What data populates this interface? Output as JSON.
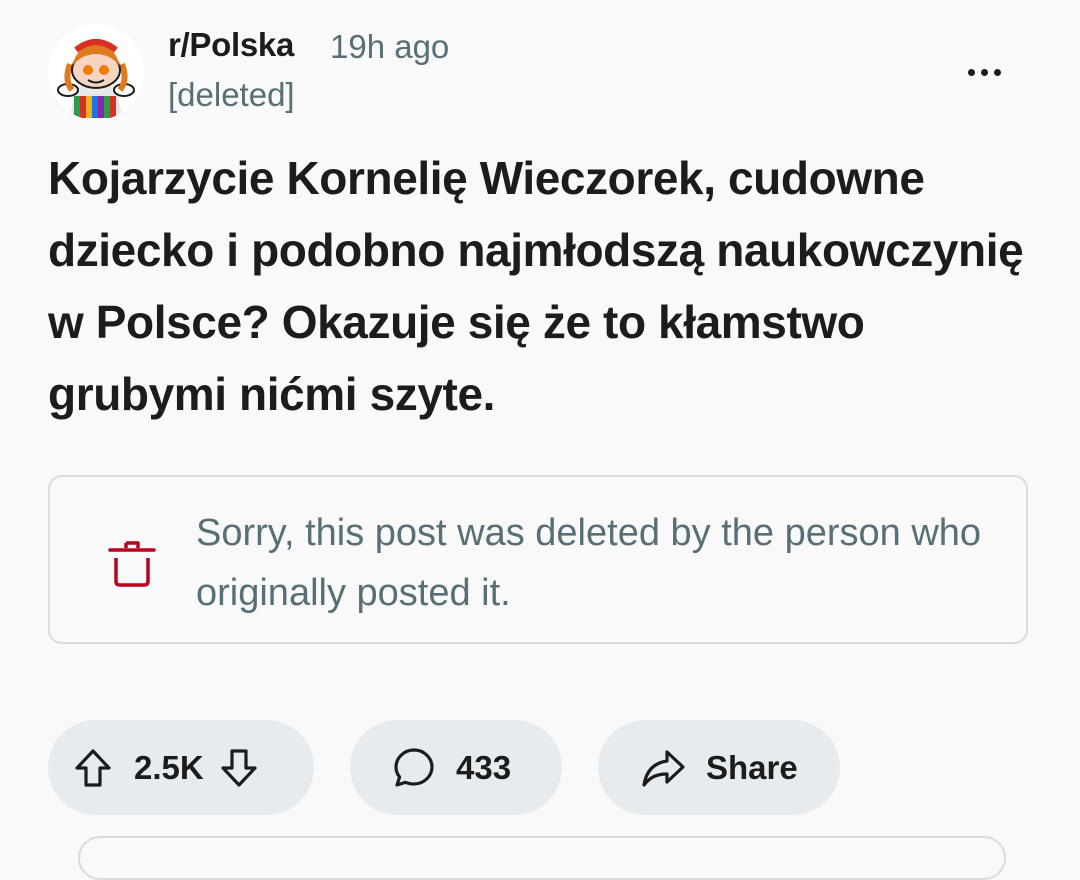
{
  "post": {
    "subreddit": "r/Polska",
    "time": "19h ago",
    "author": "[deleted]",
    "title": "Kojarzycie Kornelię Wieczorek, cudowne dziecko i podobno najmłodszą naukowczynię w Polsce? Okazuje się że to kłamstwo grubymi nićmi szyte.",
    "deleted_notice": "Sorry, this post was deleted by the person who originally posted it."
  },
  "actions": {
    "upvote_count": "2.5K",
    "comment_count": "433",
    "share_label": "Share"
  },
  "icons": {
    "overflow": "more-horizontal-icon",
    "deleted": "trash-icon",
    "upvote": "arrow-up-icon",
    "downvote": "arrow-down-icon",
    "comment": "speech-bubble-icon",
    "share": "share-arrow-icon"
  },
  "colors": {
    "background": "#f9f9f9",
    "text": "#1c1c1c",
    "muted": "#576f76",
    "pill": "#e5ebee",
    "trash": "#b8001f",
    "box_border": "#d9dcde"
  }
}
